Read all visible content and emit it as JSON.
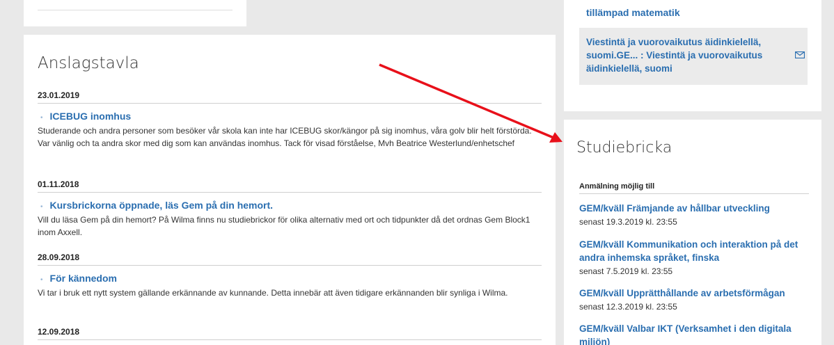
{
  "bulletin": {
    "heading": "Anslagstavla",
    "items": [
      {
        "date": "23.01.2019",
        "title": "ICEBUG inomhus",
        "body": "Studerande och andra personer som besöker vår skola kan inte har ICEBUG skor/kängor på sig inomhus, våra golv blir helt förstörda. Var vänlig och ta andra skor med dig som kan användas inomhus. Tack för visad förståelse, Mvh Beatrice Westerlund/enhetschef"
      },
      {
        "date": "01.11.2018",
        "title": "Kursbrickorna öppnade, läs Gem på din hemort.",
        "body": "Vill du läsa Gem på din hemort? På Wilma finns nu studiebrickor för olika alternativ med ort och tidpunkter då det ordnas Gem Block1 inom Axxell."
      },
      {
        "date": "28.09.2018",
        "title": "För kännedom",
        "body": "Vi tar i bruk ett nytt system gällande erkännande av kunnande. Detta innebär att även tidigare erkännanden blir synliga i Wilma."
      },
      {
        "date": "12.09.2018",
        "title": "",
        "body": ""
      }
    ]
  },
  "messages": {
    "top_link": "tillämpad matematik",
    "item": "Viestintä ja vuorovaikutus äidinkielellä, suomi.GE... : Viestintä ja vuorovaikutus äidinkielellä, suomi"
  },
  "studiebricka": {
    "heading": "Studiebricka",
    "subheading": "Anmälning möjlig till",
    "courses": [
      {
        "title": "GEM/kväll Främjande av hållbar utveckling",
        "deadline": "senast 19.3.2019 kl. 23:55"
      },
      {
        "title": "GEM/kväll Kommunikation och interaktion på det andra inhemska språket, finska",
        "deadline": "senast 7.5.2019 kl. 23:55"
      },
      {
        "title": "GEM/kväll Upprätthållande av arbetsförmågan",
        "deadline": "senast 12.3.2019 kl. 23:55"
      },
      {
        "title": "GEM/kväll Valbar IKT (Verksamhet i den digitala miljön)",
        "deadline": ""
      }
    ]
  },
  "colors": {
    "link": "#2a6eb0",
    "arrow": "#e8101a",
    "background": "#e9e9e9"
  }
}
